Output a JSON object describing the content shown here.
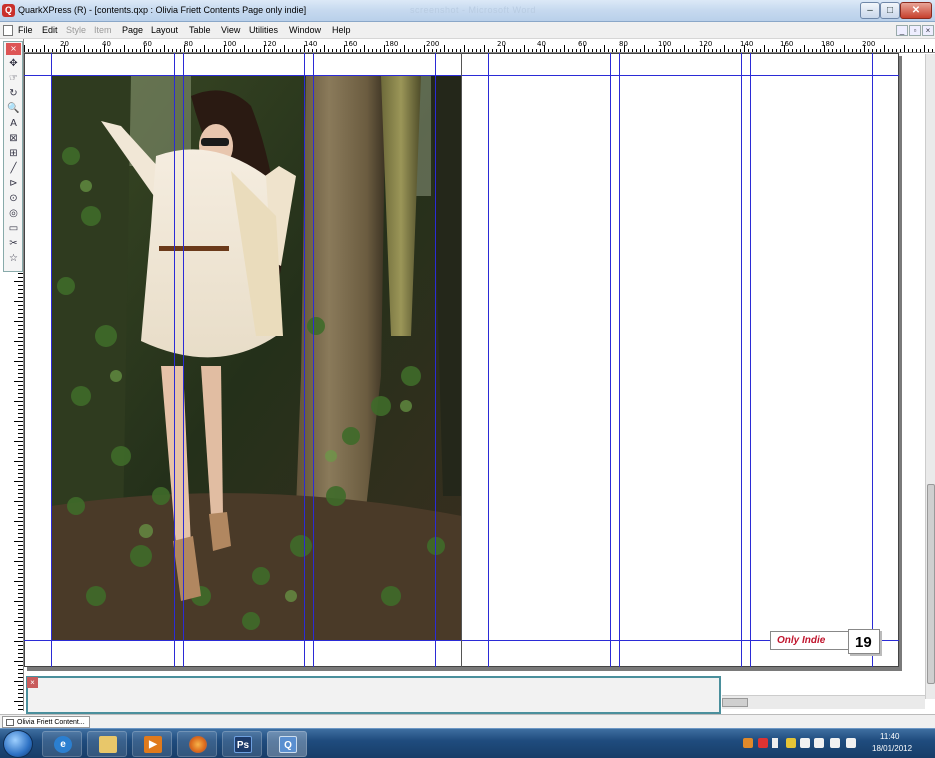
{
  "window": {
    "title": "QuarkXPress (R) - [contents.qxp : Olivia Friett Contents Page only indie]",
    "ghost_title": "screenshot - Microsoft Word",
    "min_label": "–",
    "max_label": "□",
    "close_label": "✕"
  },
  "menu": {
    "items": [
      "File",
      "Edit",
      "Style",
      "Item",
      "Page",
      "Layout",
      "Table",
      "View",
      "Utilities",
      "Window",
      "Help"
    ],
    "disabled": [
      "Style",
      "Item"
    ],
    "mdi_buttons": [
      "_",
      "▫",
      "×"
    ]
  },
  "rulers": {
    "horizontal_labels": [
      "20",
      "40",
      "60",
      "80",
      "100",
      "120",
      "140",
      "160",
      "180",
      "200",
      "20",
      "40",
      "60",
      "80",
      "100",
      "120",
      "140",
      "160",
      "180",
      "200"
    ],
    "vertical_labels": [
      "20",
      "40",
      "60",
      "80",
      "100",
      "120",
      "140",
      "160",
      "180",
      "200",
      "220",
      "240",
      "260",
      "280",
      "300"
    ]
  },
  "tools": {
    "close": "×",
    "glyphs": [
      "✥",
      "☞",
      "↻",
      "🔍",
      "A",
      "⊠",
      "⊞",
      "╱",
      "⊳",
      "⊙",
      "◎",
      "▭",
      "✂",
      "✂",
      "☆"
    ],
    "names": [
      "item-tool",
      "content-tool",
      "rotation-tool",
      "zoom-tool",
      "text-box-tool",
      "picture-box-tool",
      "table-tool",
      "line-tool",
      "line-text-path-tool",
      "linking-tool",
      "unlinking-tool",
      "scissors-tool",
      "scissors-alt-tool",
      "starburst-tool",
      "star-tool"
    ]
  },
  "document": {
    "logo_text": "Only Indie",
    "page_number": "19",
    "tab_label": "Olivia Friett Content..."
  },
  "colors": {
    "guide": "#2b2bd6",
    "logo": "#c0152d",
    "measure_border": "#4a8f9c"
  },
  "taskbar": {
    "apps": [
      {
        "name": "internet-explorer",
        "glyph": "e",
        "color": "#2b7fd0"
      },
      {
        "name": "windows-explorer",
        "glyph": "",
        "color": "#e8c76a"
      },
      {
        "name": "media-player",
        "glyph": "▶",
        "color": "#e07a1c"
      },
      {
        "name": "firefox",
        "glyph": "",
        "color": "#d9661a"
      },
      {
        "name": "photoshop",
        "glyph": "Ps",
        "color": "#1d3b6a"
      },
      {
        "name": "quark",
        "glyph": "Q",
        "color": "#5a8fd0"
      }
    ],
    "time": "11:40",
    "date": "18/01/2012"
  }
}
